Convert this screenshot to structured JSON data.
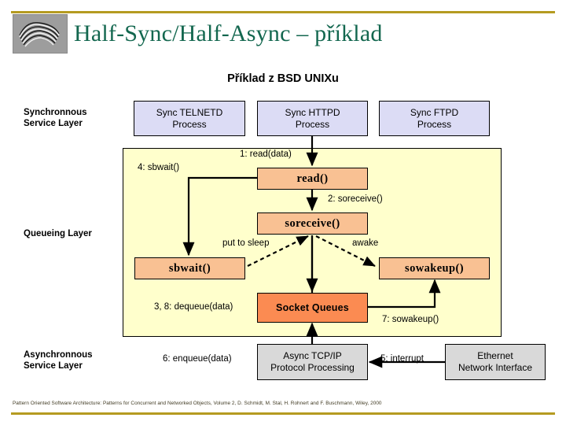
{
  "header": {
    "title": "Half-Sync/Half-Async – příklad",
    "logo_icon": "scribble-logo-icon",
    "accent_color": "#b59b21",
    "title_color": "#13674f"
  },
  "subtitle": "Příklad z BSD UNIXu",
  "layers": {
    "synchronous": "Synchronnous\nService Layer",
    "synchronous_line1": "Synchronnous",
    "synchronous_line2": "Service Layer",
    "queueing": "Queueing Layer",
    "asynchronous_line1": "Asynchronnous",
    "asynchronous_line2": "Service Layer"
  },
  "processes": [
    {
      "line1": "Sync TELNETD",
      "line2": "Process"
    },
    {
      "line1": "Sync HTTPD",
      "line2": "Process"
    },
    {
      "line1": "Sync FTPD",
      "line2": "Process"
    }
  ],
  "functions": {
    "read": "read",
    "read_paren": "()",
    "soreceive": "soreceive",
    "soreceive_paren": "()",
    "sbwait": "sbwait",
    "sbwait_paren": "()",
    "sowakeup": "sowakeup()",
    "socket_queues": "Socket Queues"
  },
  "async_boxes": [
    {
      "line1": "Async TCP/IP",
      "line2": "Protocol Processing"
    },
    {
      "line1": "Ethernet",
      "line2": "Network Interface"
    }
  ],
  "edge_labels": {
    "read_data": "1: read(data)",
    "sbwait_call": "4: sbwait()",
    "soreceive_call": "2: soreceive()",
    "put_to_sleep": "put to sleep",
    "awake": "awake",
    "dequeue": "3, 8: dequeue(data)",
    "sowakeup7": "7: sowakeup()",
    "enqueue": "6: enqueue(data)",
    "interrupt": "5: interrupt"
  },
  "footer": "Pattern Oriented Software Architecture: Patterns for Concurrent and Networked Objects, Volume 2, D. Schmidt, M. Stal, H. Rohnert and F. Buschmann, Wiley, 2000",
  "colors": {
    "panel_fill": "#ffffcc",
    "process_fill": "#dcdcf5",
    "function_fill": "#f9c193",
    "socket_fill": "#fb8b52",
    "gray_fill": "#d9d9d9",
    "rule": "#b59b21"
  }
}
